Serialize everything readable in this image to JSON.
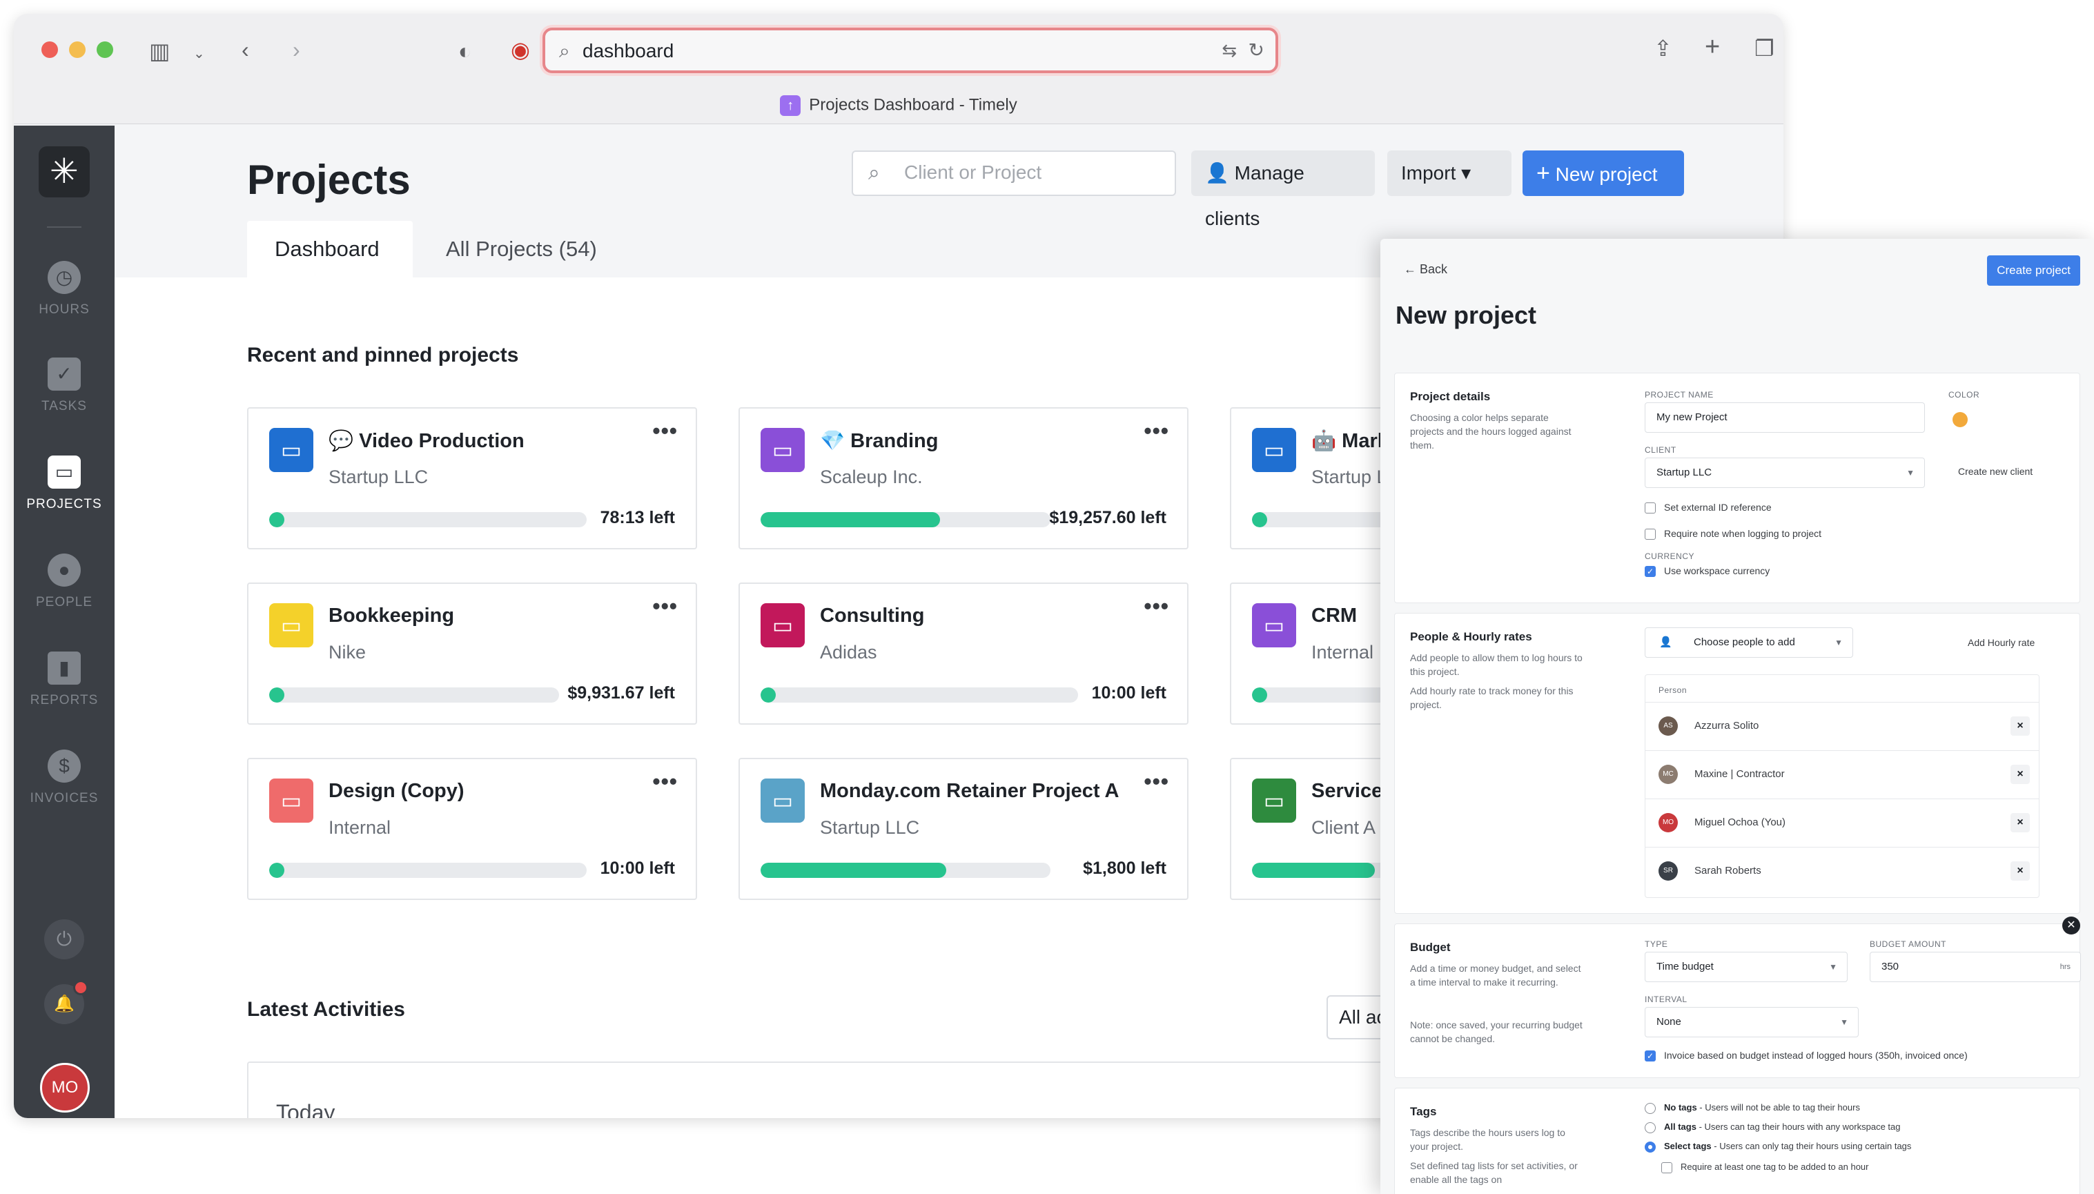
{
  "browser": {
    "address": "dashboard",
    "tab_title": "Projects Dashboard - Timely",
    "favicon_glyph": "↑"
  },
  "sidebar": {
    "logo_glyph": "✳",
    "items": [
      {
        "label": "HOURS",
        "icon": "clock-icon",
        "glyph": "◷"
      },
      {
        "label": "TASKS",
        "icon": "clipboard-check-icon",
        "glyph": "✓"
      },
      {
        "label": "PROJECTS",
        "icon": "briefcase-icon",
        "glyph": "▭"
      },
      {
        "label": "PEOPLE",
        "icon": "person-icon",
        "glyph": "●"
      },
      {
        "label": "REPORTS",
        "icon": "bar-chart-icon",
        "glyph": "▮"
      },
      {
        "label": "INVOICES",
        "icon": "dollar-icon",
        "glyph": "$"
      }
    ],
    "plug_glyph": "⏻",
    "bell_glyph": "🔔",
    "avatar_initials": "MO"
  },
  "header": {
    "title": "Projects",
    "search_placeholder": "Client or Project",
    "manage_clients": "Manage clients",
    "import": "Import",
    "new_project": "New project",
    "tabs": [
      "Dashboard",
      "All Projects (54)"
    ]
  },
  "recent_title": "Recent and pinned projects",
  "projects": [
    {
      "name": "💬 Video Production",
      "client": "Startup LLC",
      "left": "78:13 left",
      "color": "#1f6fd1",
      "progress": 0.0
    },
    {
      "name": "💎 Branding",
      "client": "Scaleup Inc.",
      "left": "$19,257.60 left",
      "color": "#8a4fd8",
      "progress": 0.62
    },
    {
      "name": "🤖 Marke",
      "client": "Startup LLC",
      "left": "",
      "color": "#1f6fd1",
      "progress": 0.0
    },
    {
      "name": "Bookkeeping",
      "client": "Nike",
      "left": "$9,931.67 left",
      "color": "#f4d12a",
      "progress": 0.0
    },
    {
      "name": "Consulting",
      "client": "Adidas",
      "left": "10:00 left",
      "color": "#c2185b",
      "progress": 0.0
    },
    {
      "name": "CRM",
      "client": "Internal",
      "left": "",
      "color": "#8a4fd8",
      "progress": 0.0
    },
    {
      "name": "Design (Copy)",
      "client": "Internal",
      "left": "10:00 left",
      "color": "#ef6b6b",
      "progress": 0.0
    },
    {
      "name": "Monday.com Retainer Project A",
      "client": "Startup LLC",
      "left": "$1,800 left",
      "color": "#5aa3c8",
      "progress": 0.64
    },
    {
      "name": "Services",
      "client": "Client A",
      "left": "",
      "color": "#2e8b3e",
      "progress": 0.3
    }
  ],
  "activities": {
    "title": "Latest Activities",
    "filter": "All ac",
    "today": "Today"
  },
  "new_project": {
    "back": "Back",
    "create": "Create project",
    "title": "New project",
    "details": {
      "title": "Project details",
      "desc": "Choosing a color helps separate projects and the hours logged against them.",
      "name_label": "PROJECT NAME",
      "name_value": "My new Project",
      "color_label": "COLOR",
      "color": "#f2a93b",
      "client_label": "CLIENT",
      "client_value": "Startup LLC",
      "create_client": "Create new client",
      "ext_id": "Set external ID reference",
      "require_note": "Require note when logging to project",
      "currency_label": "CURRENCY",
      "currency": "Use workspace currency"
    },
    "people": {
      "title": "People & Hourly rates",
      "desc1": "Add people to allow them to log hours to this project.",
      "desc2": "Add hourly rate to track money for this project.",
      "choose": "Choose people to add",
      "add_rate": "Add Hourly rate",
      "header": "Person",
      "list": [
        {
          "name": "Azzurra Solito",
          "initials": "AS"
        },
        {
          "name": "Maxine | Contractor",
          "initials": "MC"
        },
        {
          "name": "Miguel Ochoa (You)",
          "initials": "MO"
        },
        {
          "name": "Sarah Roberts",
          "initials": "SR"
        }
      ]
    },
    "budget": {
      "title": "Budget",
      "desc": "Add a time or money budget, and select a time interval to make it recurring.",
      "note": "Note: once saved, your recurring budget cannot be changed.",
      "type_label": "TYPE",
      "type_value": "Time budget",
      "amount_label": "BUDGET AMOUNT",
      "amount_value": "350",
      "amount_unit": "hrs",
      "interval_label": "INTERVAL",
      "interval_value": "None",
      "invoice_opt": "Invoice based on budget instead of logged hours (350h, invoiced once)"
    },
    "tags": {
      "title": "Tags",
      "desc1": "Tags describe the hours users log to your project.",
      "desc2": "Set defined tag lists for set activities, or enable all the tags on",
      "opt1_b": "No tags",
      "opt1": " - Users will not be able to tag their hours",
      "opt2_b": "All tags",
      "opt2": " - Users can tag their hours with any workspace tag",
      "opt3_b": "Select tags",
      "opt3": " - Users can only tag their hours using certain tags",
      "require": "Require at least one tag to be added to an hour"
    }
  }
}
